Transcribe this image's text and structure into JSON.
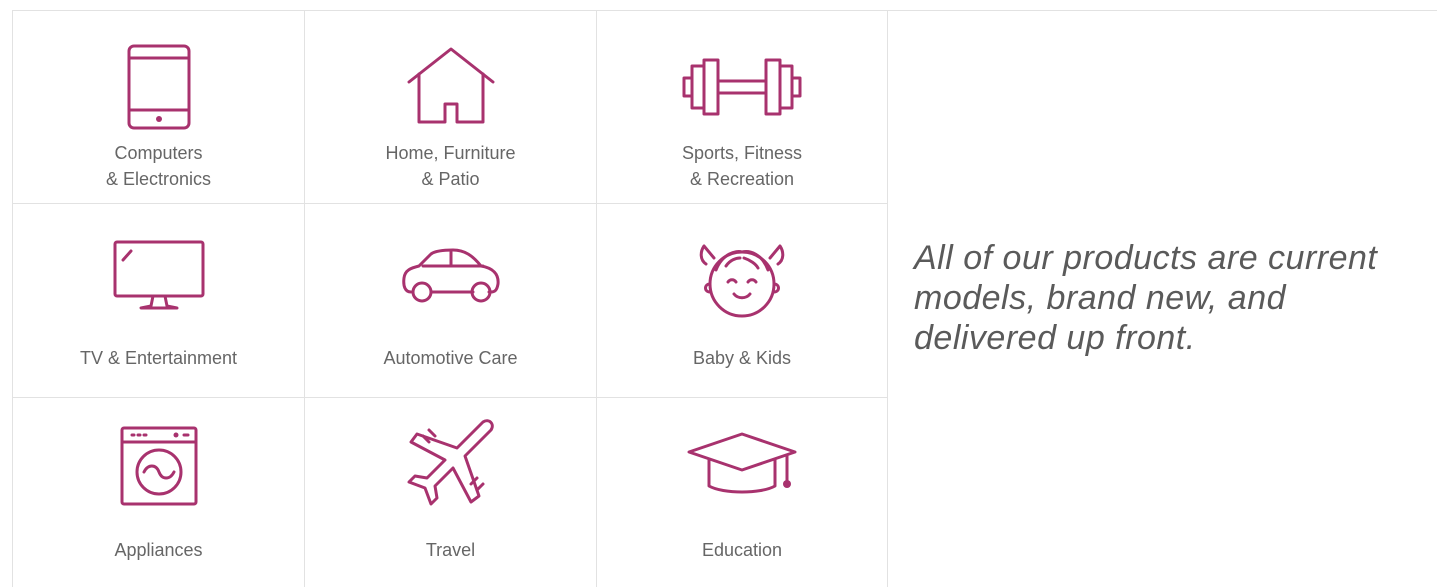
{
  "categories": [
    {
      "label": "Computers\n& Electronics",
      "icon": "tablet-icon"
    },
    {
      "label": "Home, Furniture\n& Patio",
      "icon": "house-icon"
    },
    {
      "label": "Sports, Fitness\n& Recreation",
      "icon": "dumbbell-icon"
    },
    {
      "label": "TV & Entertainment",
      "icon": "monitor-icon"
    },
    {
      "label": "Automotive Care",
      "icon": "car-icon"
    },
    {
      "label": "Baby & Kids",
      "icon": "baby-face-icon"
    },
    {
      "label": "Appliances",
      "icon": "washing-machine-icon"
    },
    {
      "label": "Travel",
      "icon": "airplane-icon"
    },
    {
      "label": "Education",
      "icon": "graduation-cap-icon"
    }
  ],
  "tagline": "All of our products are current models, brand new, and delivered up front.",
  "colors": {
    "accent": "#a8326e",
    "text": "#666666",
    "border": "#e2e2e2"
  }
}
